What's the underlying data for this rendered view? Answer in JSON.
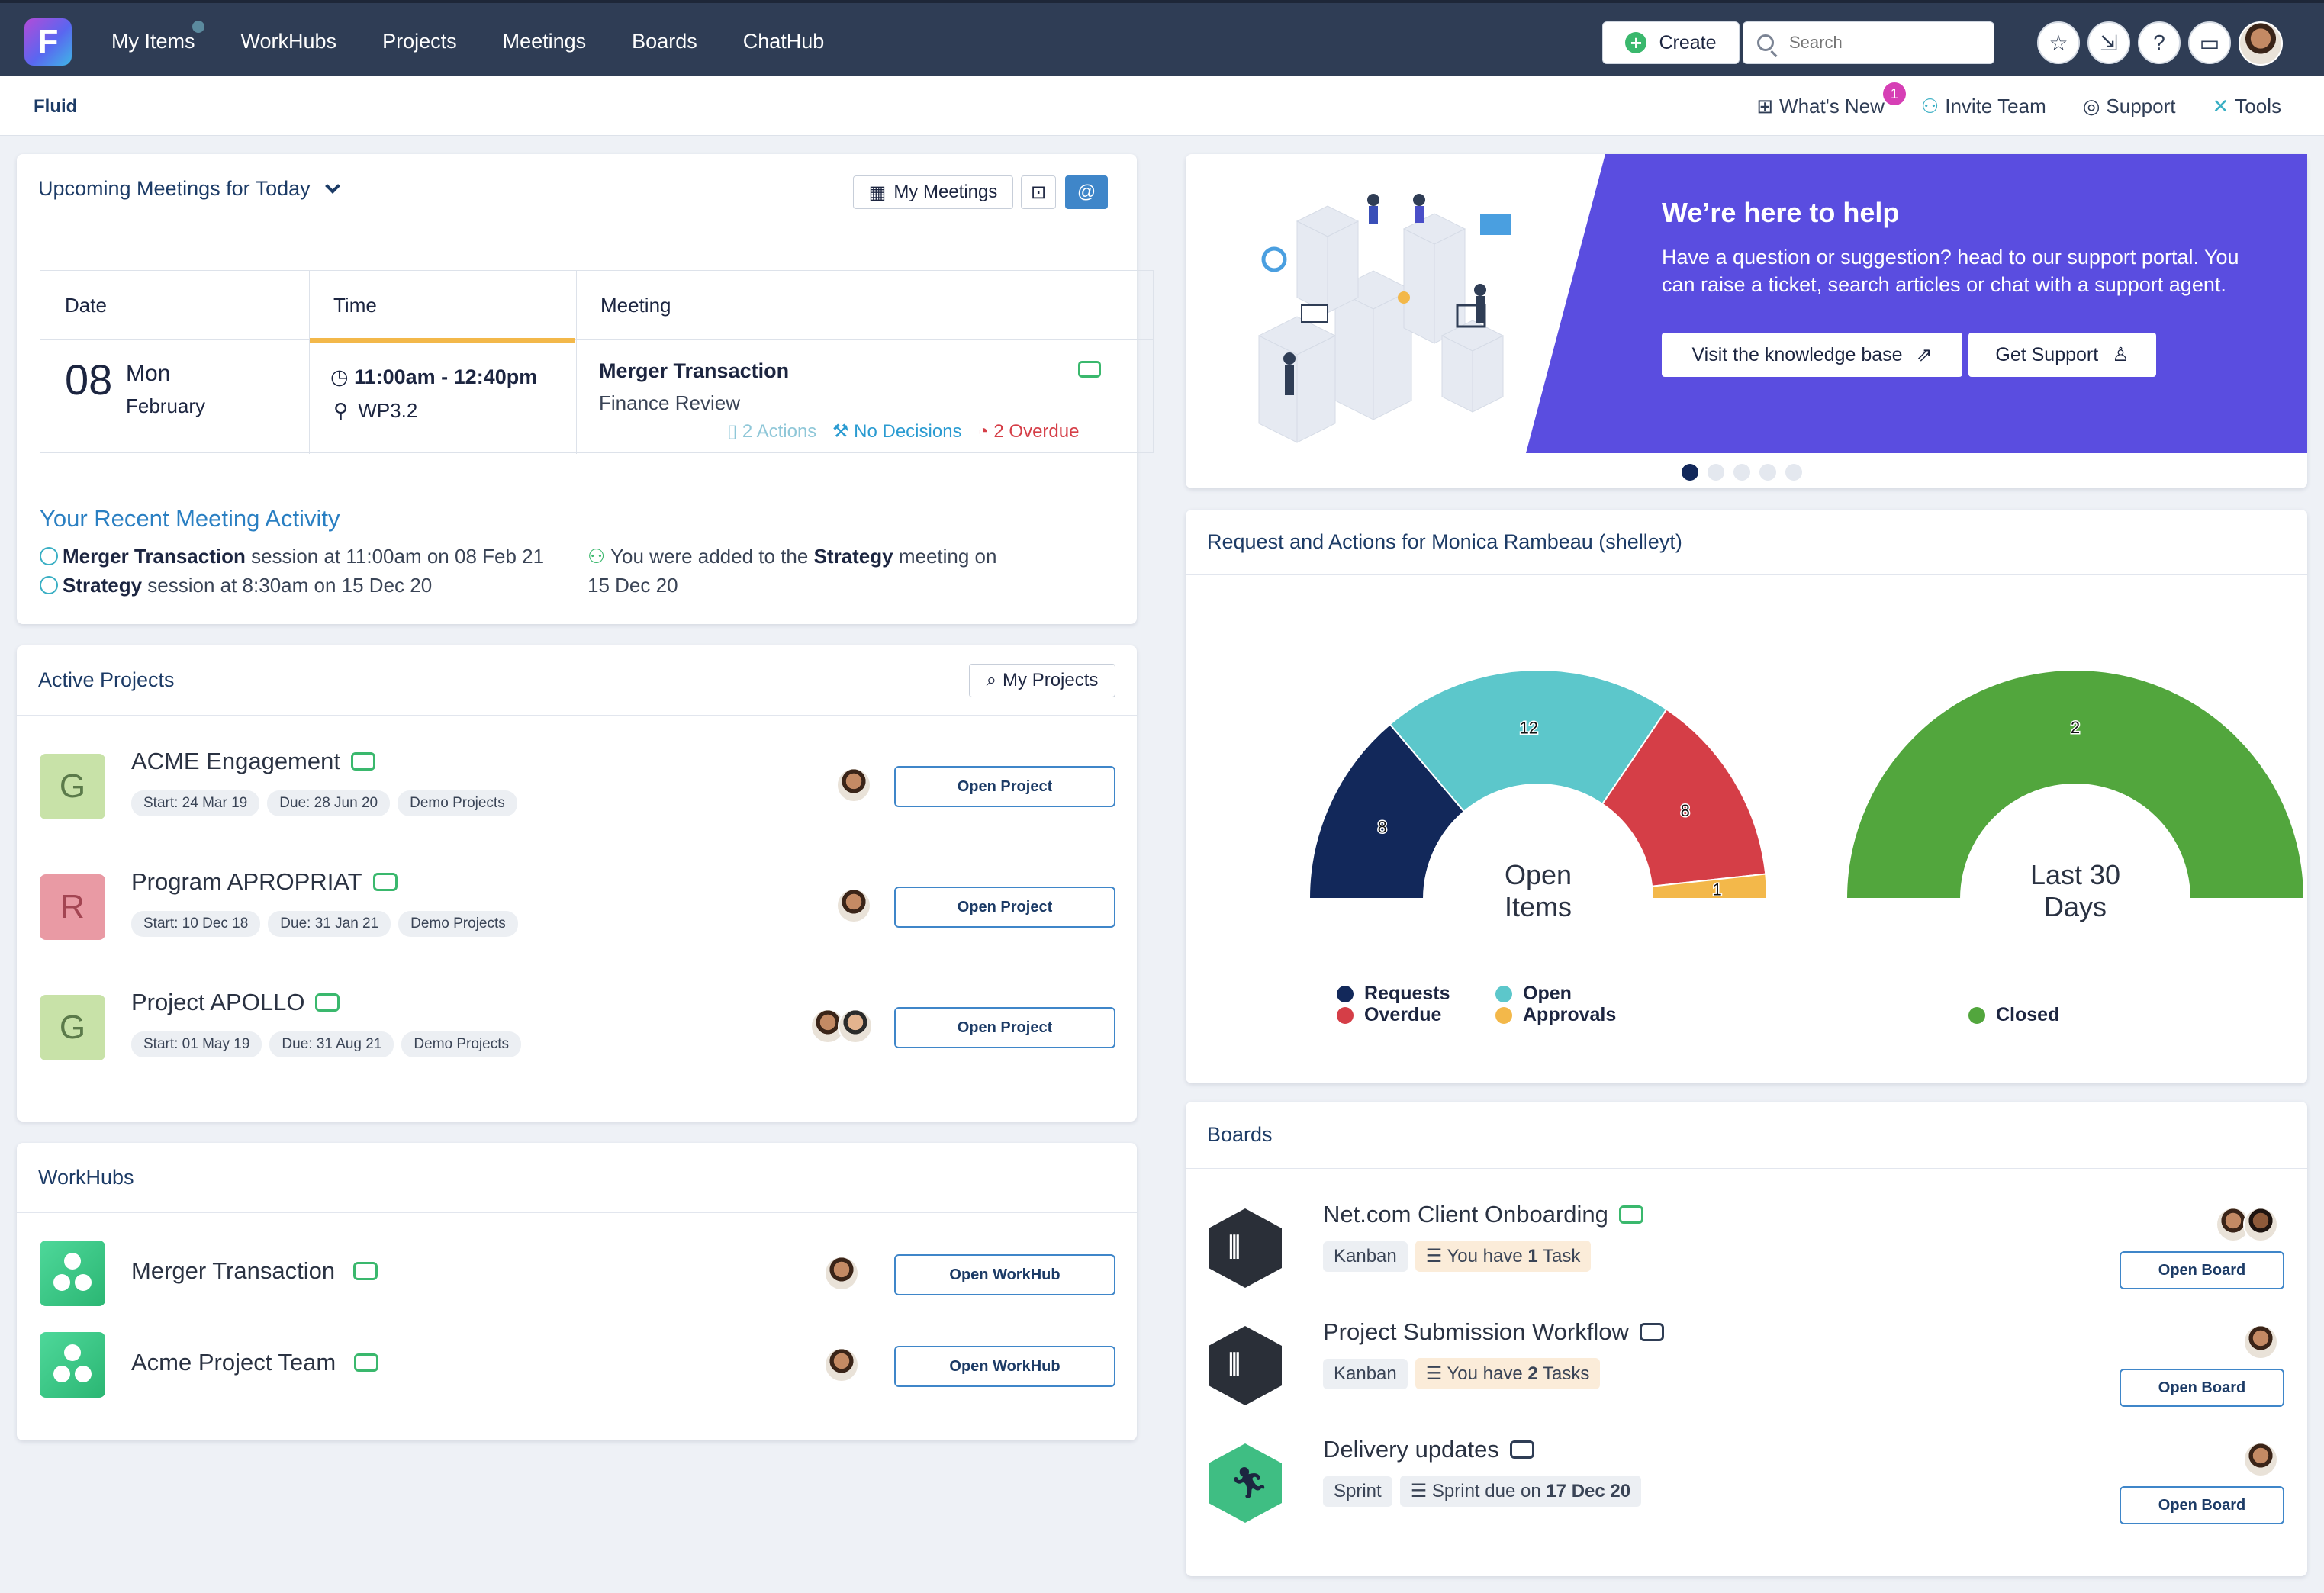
{
  "nav": {
    "logo_letter": "F",
    "links": [
      "My Items",
      "WorkHubs",
      "Projects",
      "Meetings",
      "Boards",
      "ChatHub"
    ],
    "create_label": "Create",
    "search_placeholder": "Search"
  },
  "subbar": {
    "brand": "Fluid",
    "whats_new": "What's New",
    "whats_new_badge": "1",
    "invite_team": "Invite Team",
    "support": "Support",
    "tools": "Tools"
  },
  "meetings": {
    "title": "Upcoming Meetings for Today",
    "my_meetings_label": "My Meetings",
    "at_label": "@",
    "headers": {
      "date": "Date",
      "time": "Time",
      "meeting": "Meeting"
    },
    "row": {
      "day": "08",
      "weekday": "Mon",
      "month": "February",
      "time": "11:00am - 12:40pm",
      "location": "WP3.2",
      "name": "Merger Transaction",
      "subtitle": "Finance Review",
      "actions": "2 Actions",
      "decisions": "No Decisions",
      "overdue": "2 Overdue"
    },
    "activity_title": "Your Recent Meeting Activity",
    "activity": [
      {
        "bold": "Merger Transaction",
        "text": " session at 11:00am on 08 Feb 21"
      },
      {
        "bold": "Strategy",
        "text": " session at 8:30am on 15 Dec 20"
      }
    ],
    "activity_added_prefix": "You were added to the ",
    "activity_added_bold": "Strategy",
    "activity_added_suffix": " meeting on",
    "activity_added_date": "15 Dec 20"
  },
  "projects": {
    "title": "Active Projects",
    "my_projects_label": "My Projects",
    "items": [
      {
        "letter": "G",
        "name": "ACME Engagement",
        "start": "Start: 24 Mar 19",
        "due": "Due: 28 Jun 20",
        "group": "Demo Projects",
        "button": "Open Project",
        "color": "#c8e2a8"
      },
      {
        "letter": "R",
        "name": "Program APROPRIAT",
        "start": "Start: 10 Dec 18",
        "due": "Due: 31 Jan 21",
        "group": "Demo Projects",
        "button": "Open Project",
        "color": "#e99aa4"
      },
      {
        "letter": "G",
        "name": "Project APOLLO",
        "start": "Start: 01 May 19",
        "due": "Due: 31 Aug 21",
        "group": "Demo Projects",
        "button": "Open Project",
        "color": "#c8e2a8"
      }
    ]
  },
  "workhubs": {
    "title": "WorkHubs",
    "items": [
      {
        "name": "Merger Transaction",
        "button": "Open WorkHub"
      },
      {
        "name": "Acme Project Team",
        "button": "Open WorkHub"
      }
    ]
  },
  "banner": {
    "title": "We’re here to help",
    "line1": "Have a question or suggestion? head to our support portal. You",
    "line2": "can raise a ticket, search articles or chat with a support agent.",
    "kb_button": "Visit the knowledge base",
    "support_button": "Get Support"
  },
  "requests": {
    "title": "Request and Actions for Monica Rambeau (shelleyt)",
    "center1_line1": "Open",
    "center1_line2": "Items",
    "center2_line1": "Last 30",
    "center2_line2": "Days",
    "legend": {
      "requests": "Requests",
      "overdue": "Overdue",
      "open": "Open",
      "approvals": "Approvals",
      "closed": "Closed"
    }
  },
  "chart_data": {
    "type": "pie",
    "charts": [
      {
        "center_label": "Open Items",
        "slices": [
          {
            "name": "Requests",
            "value": 8,
            "color": "#12285a"
          },
          {
            "name": "Open",
            "value": 12,
            "color": "#5cc7cb"
          },
          {
            "name": "Overdue",
            "value": 8,
            "color": "#d53e47"
          },
          {
            "name": "Approvals",
            "value": 1,
            "color": "#f3b84a"
          }
        ]
      },
      {
        "center_label": "Last 30 Days",
        "slices": [
          {
            "name": "Closed",
            "value": 2,
            "color": "#52a63d"
          }
        ]
      }
    ]
  },
  "boards": {
    "title": "Boards",
    "items": [
      {
        "name": "Net.com Client Onboarding",
        "type": "Kanban",
        "task_prefix": "You have ",
        "task_bold": "1",
        "task_suffix": " Task",
        "button": "Open Board",
        "hex_color": "#2a2f38",
        "avatars": 2
      },
      {
        "name": "Project Submission Workflow",
        "type": "Kanban",
        "task_prefix": "You have ",
        "task_bold": "2",
        "task_suffix": " Tasks",
        "button": "Open Board",
        "hex_color": "#2a2f38",
        "avatars": 1
      },
      {
        "name": "Delivery updates",
        "type": "Sprint",
        "task_prefix": "Sprint due on ",
        "task_bold": "17 Dec 20",
        "task_suffix": "",
        "button": "Open Board",
        "hex_color": "#3fbe83",
        "avatars": 1
      }
    ]
  }
}
